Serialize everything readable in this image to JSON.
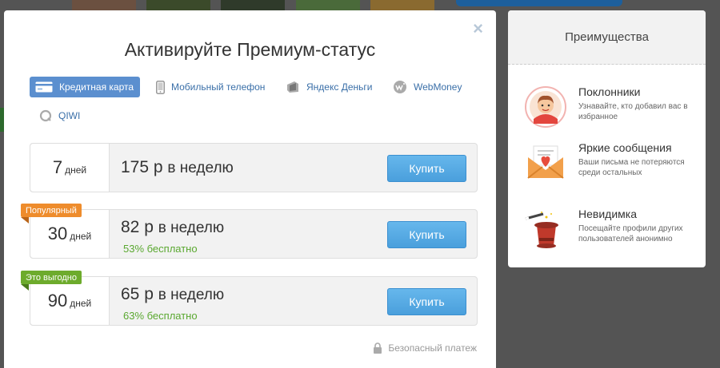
{
  "modal": {
    "title": "Активируйте Премиум-статус",
    "close_symbol": "×"
  },
  "payment_methods": [
    {
      "label": "Кредитная карта",
      "icon": "credit-card-icon",
      "active": true
    },
    {
      "label": "Мобильный телефон",
      "icon": "mobile-phone-icon",
      "active": false
    },
    {
      "label": "Яндекс Деньги",
      "icon": "yandex-money-icon",
      "active": false
    },
    {
      "label": "WebMoney",
      "icon": "webmoney-icon",
      "active": false
    },
    {
      "label": "QIWI",
      "icon": "qiwi-icon",
      "active": false
    }
  ],
  "plans": [
    {
      "days": "7",
      "days_unit": "дней",
      "price": "175 р",
      "per": "в неделю",
      "saving": "",
      "badge": "",
      "buy_label": "Купить"
    },
    {
      "days": "30",
      "days_unit": "дней",
      "price": "82 р",
      "per": "в неделю",
      "saving": "53% бесплатно",
      "badge": "Популярный",
      "badge_color": "#ee8c2c",
      "buy_label": "Купить"
    },
    {
      "days": "90",
      "days_unit": "дней",
      "price": "65 р",
      "per": "в неделю",
      "saving": "63% бесплатно",
      "badge": "Это выгодно",
      "badge_color": "#6dab2c",
      "buy_label": "Купить"
    }
  ],
  "secure_payment": "Безопасный платеж",
  "benefits": {
    "title": "Преимущества",
    "items": [
      {
        "title": "Поклонники",
        "description": "Узнавайте, кто добавил вас в избранное",
        "icon": "admirer-avatar-icon"
      },
      {
        "title": "Яркие сообщения",
        "description": "Ваши письма не потеряются среди остальных",
        "icon": "envelope-heart-icon"
      },
      {
        "title": "Невидимка",
        "description": "Посещайте профили других пользователей анонимно",
        "icon": "magic-hat-icon"
      }
    ]
  },
  "colors": {
    "accent_blue": "#5b8fcf",
    "buy_button": "#4a9fdc",
    "saving_green": "#5aa830",
    "badge_orange": "#ee8c2c",
    "badge_green": "#6dab2c"
  }
}
